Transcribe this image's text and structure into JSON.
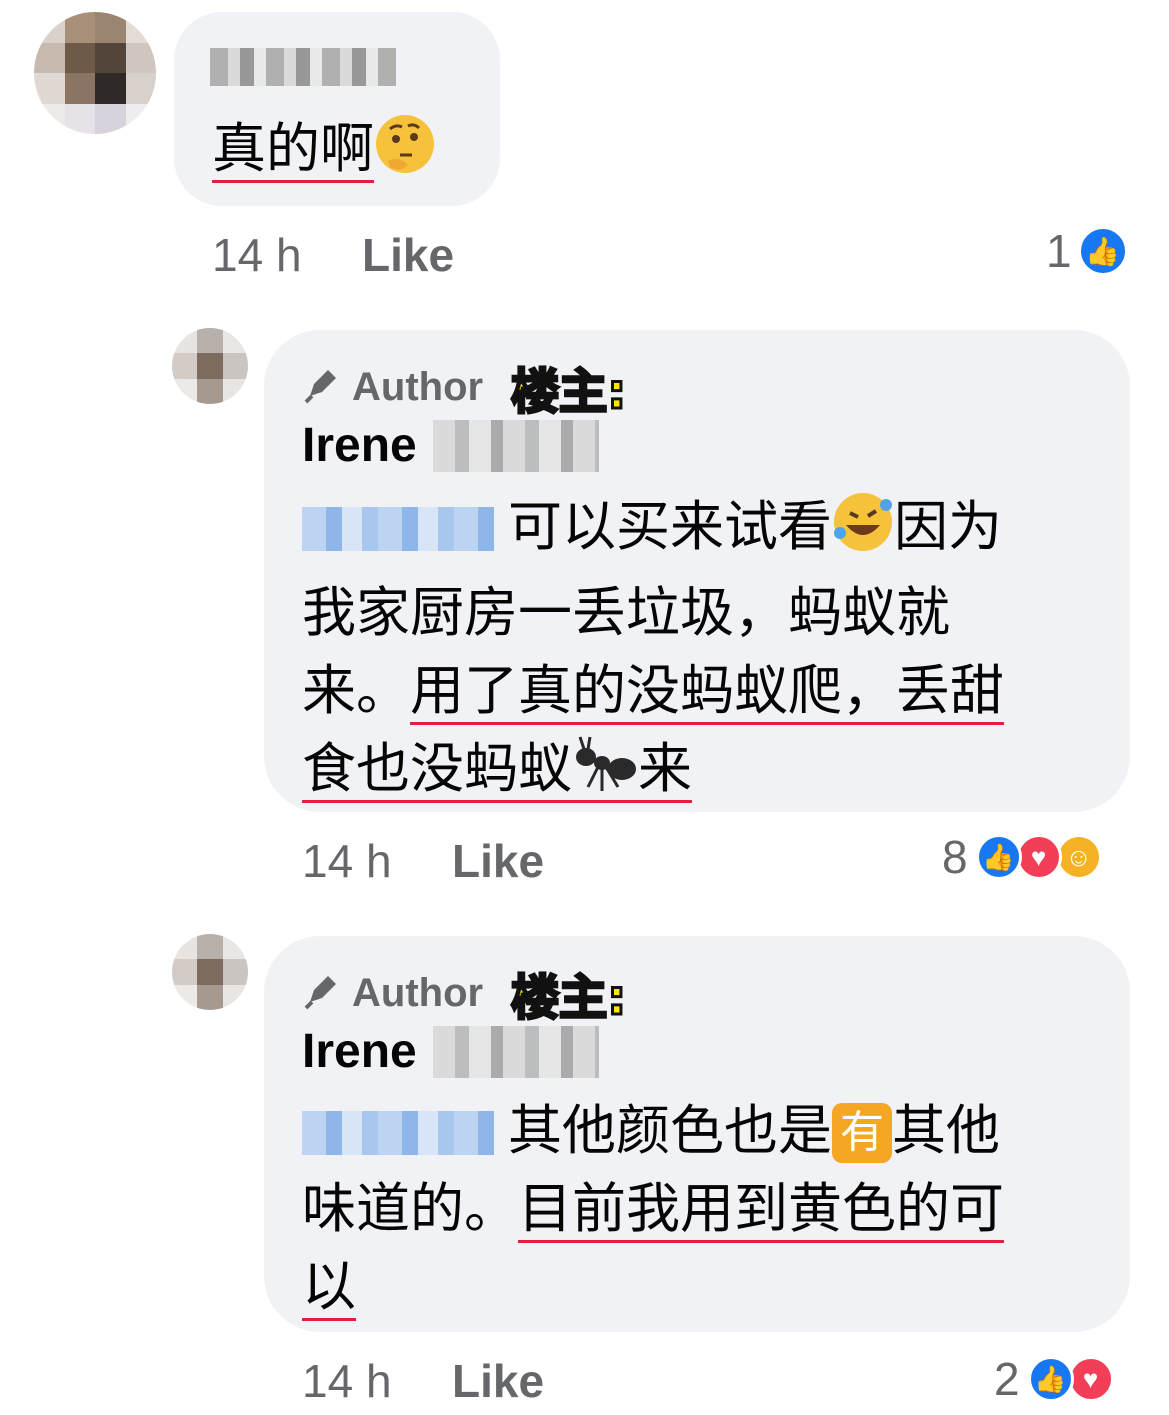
{
  "comment1": {
    "text": "真的啊",
    "time": "14 h",
    "like": "Like",
    "reaction_count": "1",
    "emoji_icon": "thinking-face"
  },
  "reply1": {
    "badge": "Author",
    "louzhu": "楼主:",
    "name": "Irene",
    "line1": "可以买来试看",
    "line1b": "因为",
    "line2": "我家厨房一丢垃圾，蚂蚁就",
    "line3a": "来。",
    "line3b": "用了真的没蚂蚁爬，丢甜",
    "line4a": "食也没蚂蚁",
    "line4b": "来",
    "time": "14 h",
    "like": "Like",
    "reaction_count": "8",
    "colors": {
      "like": "#1877f2",
      "love": "#f33e58",
      "care": "#f7b125"
    }
  },
  "reply2": {
    "badge": "Author",
    "louzhu": "楼主:",
    "name": "Irene",
    "line1a": "其他颜色也是",
    "line1_emoji": "有",
    "line1b": "其他",
    "line2a": "味道的。",
    "line2b": "目前我用到黄色的可",
    "line3": "以",
    "time": "14 h",
    "like": "Like",
    "reaction_count": "2"
  }
}
